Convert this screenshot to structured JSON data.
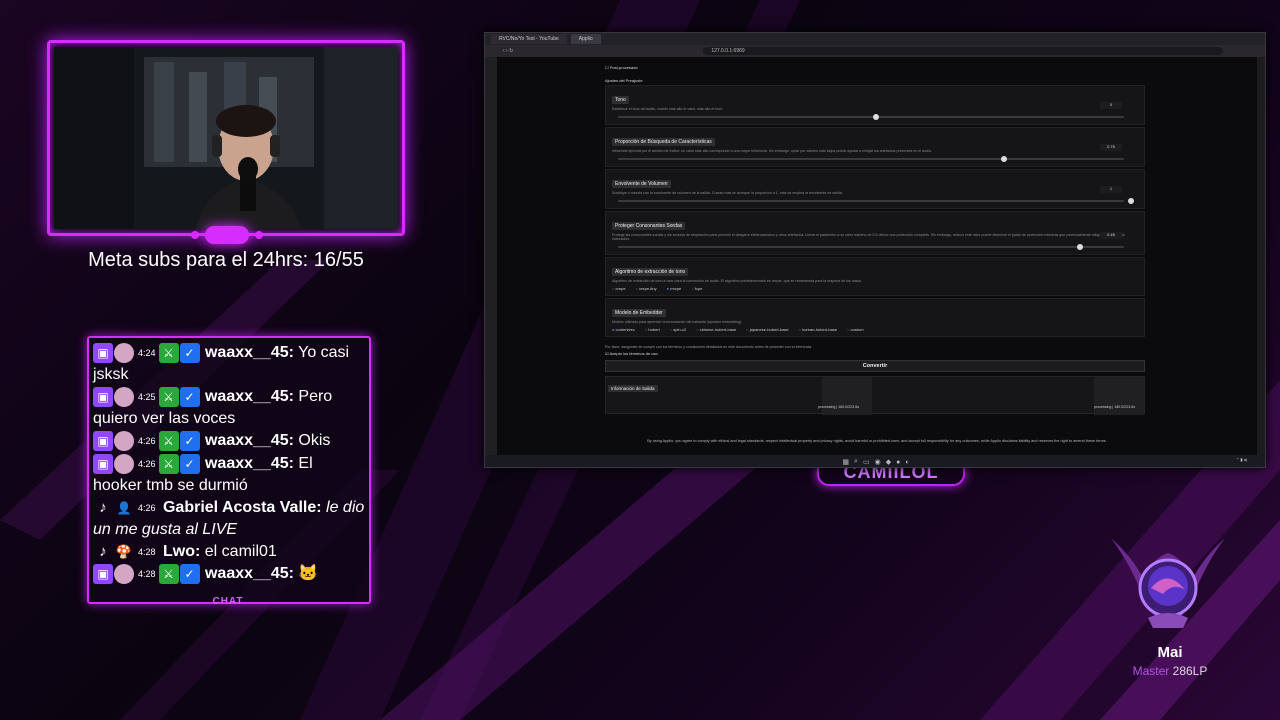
{
  "overlay": {
    "meta_text": "Meta subs para el 24hrs: 16/55",
    "chat_label": "CHAT",
    "logo_text": "CAMIILOL"
  },
  "chat": [
    {
      "platform": "twitch",
      "time": "4:24",
      "user": "waaxx__45:",
      "text": "Yo casi jsksk",
      "italic": false
    },
    {
      "platform": "twitch",
      "time": "4:25",
      "user": "waaxx__45:",
      "text": "Pero quiero ver las voces",
      "italic": false
    },
    {
      "platform": "twitch",
      "time": "4:26",
      "user": "waaxx__45:",
      "text": "Okis",
      "italic": false
    },
    {
      "platform": "twitch",
      "time": "4:26",
      "user": "waaxx__45:",
      "text": "El hooker tmb se durmió",
      "italic": false
    },
    {
      "platform": "tiktok",
      "time": "4:26",
      "user": "Gabriel Acosta Valle:",
      "text": "le dio un me gusta al LIVE",
      "italic": true
    },
    {
      "platform": "tiktok",
      "time": "4:28",
      "user": "Lwo:",
      "text": "el camil01",
      "italic": false
    },
    {
      "platform": "twitch",
      "time": "4:28",
      "user": "waaxx__45:",
      "text": "🐱",
      "italic": false
    }
  ],
  "browser": {
    "tabs": [
      "RVC/No/Yo Test - YouTube",
      "Applio"
    ],
    "url": "127.0.0.1:6969",
    "post_process_label": "Post-procesado",
    "preset_label": "Ajustes del Preajuste",
    "sections": [
      {
        "title": "Tono",
        "desc": "Establece el tono del audio, cuanto más alto el valor, más alto el tono.",
        "value": "0",
        "level": 0.5
      },
      {
        "title": "Proporción de Búsqueda de Características",
        "desc": "Influencia ejercida por el archivo de índice; un valor más alto corresponde a una mayor influencia. Sin embargo, optar por valores más bajos puede ayudar a mitigar los artefactos presentes en el audio.",
        "value": "0.75",
        "level": 0.75
      },
      {
        "title": "Envolvente de Volumen",
        "desc": "Sustituye o mezcla con la envolvente de volumen de la salida. Cuanto más se acerque la proporción a 1, más se emplea la envolvente de salida.",
        "value": "1",
        "level": 1.0
      },
      {
        "title": "Proteger Consonantes Sordas",
        "desc": "Protege las consonantes sordas y los sonidos de respiración para prevenir el desgarro electroacústico y otros artefactos. Llevar el parámetro a su valor máximo de 0.5 ofrece una protección completa. Sin embargo, reducir este valor puede disminuir el grado de protección mientras que potencialmente mitiga el efecto de la indexación.",
        "value": "0.45",
        "level": 0.9
      }
    ],
    "pitch_algo": {
      "title": "Algoritmo de extracción de tono",
      "desc": "Algoritmo de extracción de tono a usar para la conversión de audio. El algoritmo predeterminado es rmvpe, que se recomienda para la mayoría de los casos.",
      "options": [
        "crepe",
        "crepe-tiny",
        "rmvpe",
        "fcpe"
      ],
      "selected": "rmvpe"
    },
    "embedder": {
      "title": "Modelo de Embedder",
      "desc": "Modelo utilizado para aprender la incrustación del hablante (speaker embedding).",
      "options": [
        "contentvec",
        "hubert",
        "spin-v2",
        "chinese-hubert-base",
        "japanese-hubert-base",
        "korean-hubert-base",
        "custom"
      ],
      "selected": "contentvec"
    },
    "terms_text": "Por favor, asegúrate de cumplir con los términos y condiciones detallados en este documento antes de proceder con tu inferencia.",
    "accept_label": "Acepto los términos de uso",
    "convert_label": "Convertir",
    "output_label": "Información de Salida",
    "processing_1": "processing | 180.0/223.6s",
    "processing_2": "processing | 180.0/223.6s",
    "footer": "By using Applio, you agree to comply with ethical and legal standards, respect intellectual property and privacy rights, avoid harmful or prohibited uses, and accept full responsibility for any outcomes, while Applio disclaims liability and reserves the right to amend these terms."
  },
  "rank": {
    "name": "Mai",
    "tier": "Master",
    "lp": "286LP"
  },
  "colors": {
    "accent": "#d62cff",
    "tier": "#b453e8"
  }
}
